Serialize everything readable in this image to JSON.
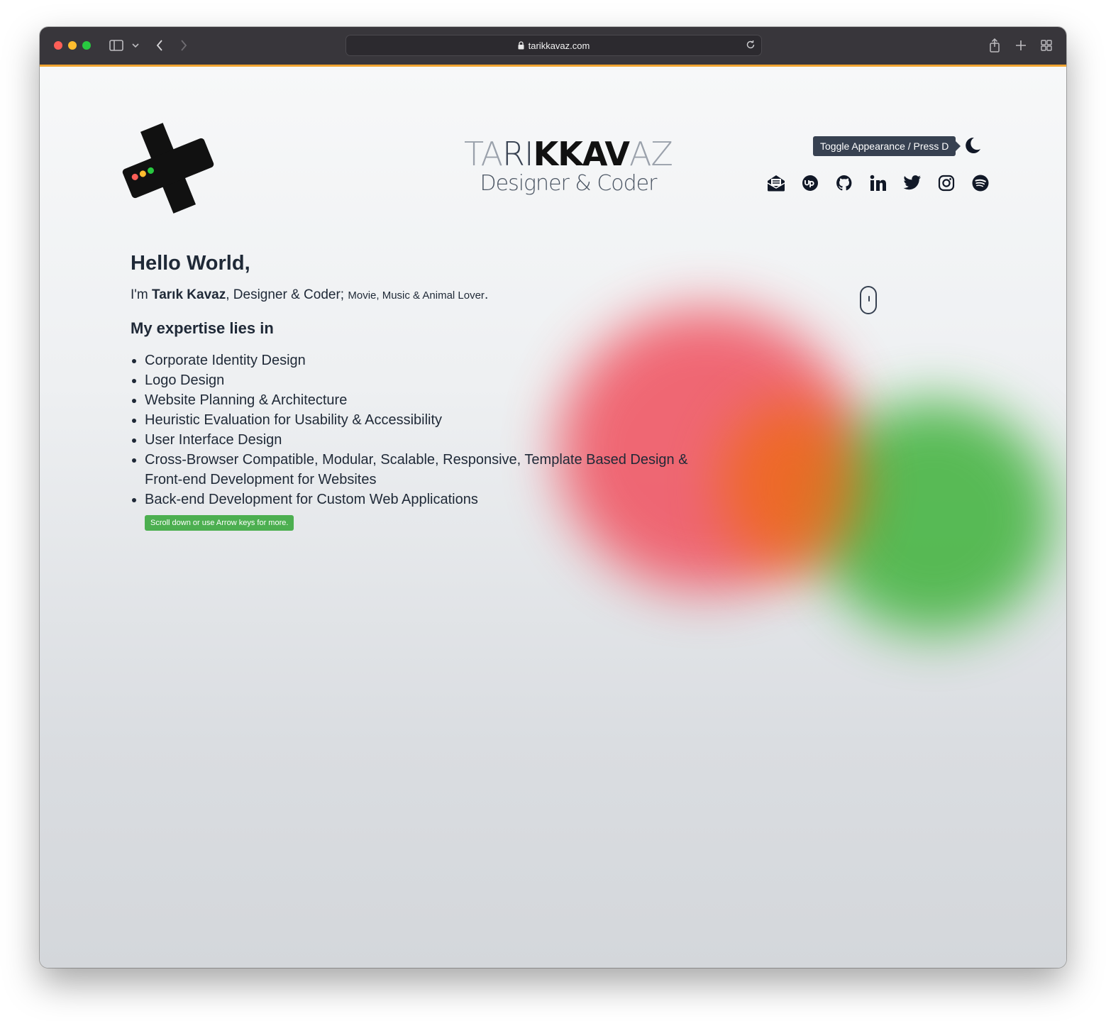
{
  "browser": {
    "url": "tarikkavaz.com",
    "icons": [
      "sidebar-icon",
      "chevron-down-icon",
      "back-icon",
      "forward-icon",
      "lock-icon",
      "reload-icon",
      "share-icon",
      "new-tab-icon",
      "tab-overview-icon"
    ]
  },
  "header": {
    "brand_light1": "TA",
    "brand_mid": "RI",
    "brand_bold": "KKAV",
    "brand_light2": "AZ",
    "tagline": "Designer & Coder",
    "toggle_tooltip": "Toggle Appearance / Press D",
    "social_icons": [
      "email-icon",
      "upwork-icon",
      "github-icon",
      "linkedin-icon",
      "twitter-icon",
      "instagram-icon",
      "spotify-icon"
    ]
  },
  "main": {
    "greeting": "Hello World,",
    "intro_prefix": "I'm ",
    "intro_name": "Tarık Kavaz",
    "intro_role": ", Designer & Coder; ",
    "intro_hobbies": "Movie, Music & Animal Lover",
    "intro_end": ".",
    "expertise_title": "My expertise lies in",
    "expertise": [
      "Corporate Identity Design",
      "Logo Design",
      "Website Planning & Architecture",
      "Heuristic Evaluation for Usability & Accessibility",
      "User Interface Design",
      "Cross-Browser Compatible, Modular, Scalable, Responsive, Template Based Design & Front-end Development for Websites",
      "Back-end Development for Custom Web Applications"
    ],
    "scroll_hint": "Scroll down or use Arrow keys for more."
  },
  "colors": {
    "accent_green": "#4caf50",
    "blob_red": "#f0505e",
    "blob_green": "#3fb23b",
    "titlebar": "#38363b"
  }
}
